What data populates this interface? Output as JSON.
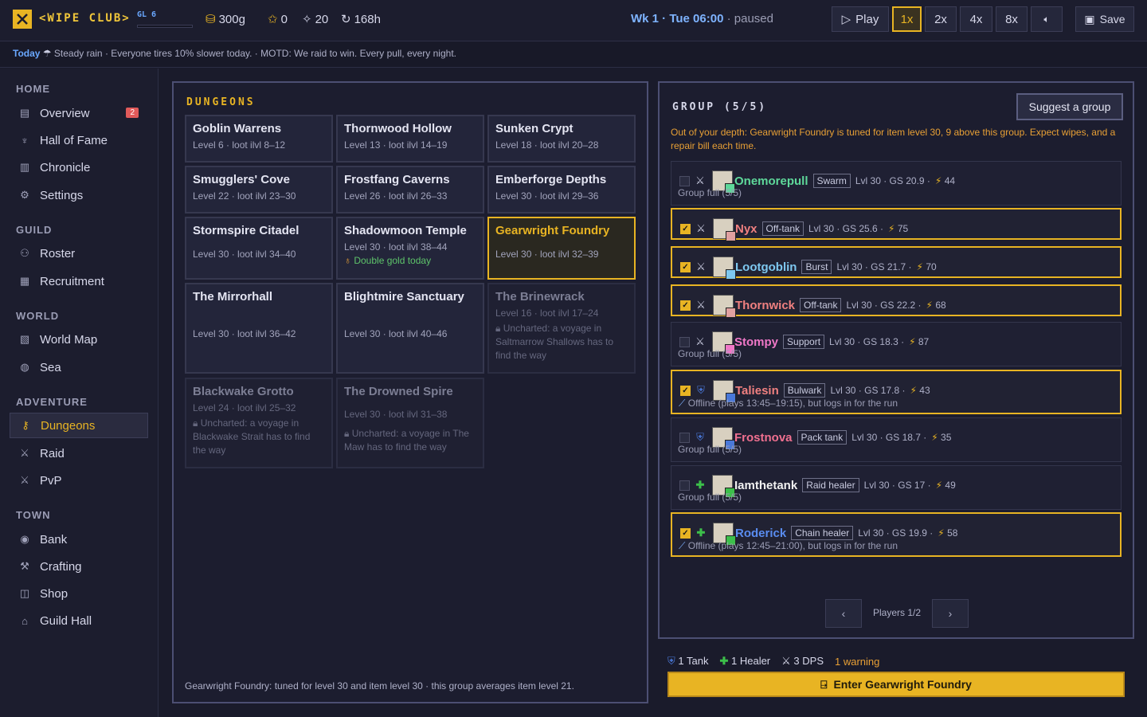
{
  "header": {
    "brand": "<WIPE CLUB>",
    "guild_level": "GL 6",
    "guild_level_progress": 0.0,
    "gold": "300g",
    "stars": "0",
    "recruits": "20",
    "hours": "168h",
    "time": "Wk 1 · Tue 06:00",
    "state": "· paused",
    "play": "Play",
    "speeds": [
      "1x",
      "2x",
      "4x",
      "8x"
    ],
    "active_speed": "1x",
    "save": "Save"
  },
  "motd": {
    "label": "Today",
    "text": "Steady rain · Everyone tires 10% slower today. · MOTD: We raid to win. Every pull, every night."
  },
  "sidebar": {
    "home": "HOME",
    "overview": "Overview",
    "overview_badge": "2",
    "hall_of_fame": "Hall of Fame",
    "chronicle": "Chronicle",
    "settings": "Settings",
    "guild": "GUILD",
    "roster": "Roster",
    "recruitment": "Recruitment",
    "world": "WORLD",
    "world_map": "World Map",
    "sea": "Sea",
    "adventure": "ADVENTURE",
    "dungeons": "Dungeons",
    "raid": "Raid",
    "pvp": "PvP",
    "town": "TOWN",
    "bank": "Bank",
    "crafting": "Crafting",
    "shop": "Shop",
    "guild_hall": "Guild Hall"
  },
  "dungeons": {
    "title": "DUNGEONS",
    "items": [
      {
        "name": "Goblin Warrens",
        "meta": "Level 6 · loot ilvl 8–12"
      },
      {
        "name": "Thornwood Hollow",
        "meta": "Level 13 · loot ilvl 14–19"
      },
      {
        "name": "Sunken Crypt",
        "meta": "Level 18 · loot ilvl 20–28"
      },
      {
        "name": "Smugglers' Cove",
        "meta": "Level 22 · loot ilvl 23–30"
      },
      {
        "name": "Frostfang Caverns",
        "meta": "Level 26 · loot ilvl 26–33"
      },
      {
        "name": "Emberforge Depths",
        "meta": "Level 30 · loot ilvl 29–36"
      },
      {
        "name": "Stormspire Citadel",
        "meta": "Level 30 · loot ilvl 34–40"
      },
      {
        "name": "Shadowmoon Temple",
        "meta": "Level 30 · loot ilvl 38–44",
        "extra": "Double gold today"
      },
      {
        "name": "Gearwright Foundry",
        "meta": "Level 30 · loot ilvl 32–39"
      },
      {
        "name": "The Mirrorhall",
        "meta": "Level 30 · loot ilvl 36–42"
      },
      {
        "name": "Blightmire Sanctuary",
        "meta": "Level 30 · loot ilvl 40–46"
      },
      {
        "name": "The Brinewrack",
        "meta": "Level 16 · loot ilvl 17–24",
        "lock": "Uncharted: a voyage in Saltmarrow Shallows has to find the way"
      },
      {
        "name": "Blackwake Grotto",
        "meta": "Level 24 · loot ilvl 25–32",
        "lock": "Uncharted: a voyage in Blackwake Strait has to find the way"
      },
      {
        "name": "The Drowned Spire",
        "meta": "Level 30 · loot ilvl 31–38",
        "lock": "Uncharted: a voyage in The Maw has to find the way"
      }
    ],
    "footer": "Gearwright Foundry: tuned for level 30 and item level 30 · this group averages item level 21."
  },
  "group": {
    "title": "GROUP (5/5)",
    "suggest": "Suggest a group",
    "warning": "Out of your depth: Gearwright Foundry is tuned for item level 30, 9 above this group. Expect wipes, and a repair bill each time.",
    "players": [
      {
        "name": "Onemorepull",
        "tag": "Swarm",
        "stats": "Lvl 30 · GS 20.9 ·",
        "energy": "44",
        "sub": "Group full (5/5)",
        "checked": false,
        "role": "dps",
        "color": "#5ed89a",
        "badge": "#5ed89a"
      },
      {
        "name": "Nyx",
        "tag": "Off-tank",
        "stats": "Lvl 30 · GS 25.6 ·",
        "energy": "75",
        "sub": "",
        "checked": true,
        "role": "dps",
        "color": "#f08080",
        "badge": "#e0a0a0"
      },
      {
        "name": "Lootgoblin",
        "tag": "Burst",
        "stats": "Lvl 30 · GS 21.7 ·",
        "energy": "70",
        "sub": "",
        "checked": true,
        "role": "dps",
        "color": "#7ec8f0",
        "badge": "#7ec8f0"
      },
      {
        "name": "Thornwick",
        "tag": "Off-tank",
        "stats": "Lvl 30 · GS 22.2 ·",
        "energy": "68",
        "sub": "",
        "checked": true,
        "role": "dps",
        "color": "#f08080",
        "badge": "#e0a0a0"
      },
      {
        "name": "Stompy",
        "tag": "Support",
        "stats": "Lvl 30 · GS 18.3 ·",
        "energy": "87",
        "sub": "Group full (5/5)",
        "checked": false,
        "role": "dps",
        "color": "#f078c8",
        "badge": "#f078c8"
      },
      {
        "name": "Taliesin",
        "tag": "Bulwark",
        "stats": "Lvl 30 · GS 17.8 ·",
        "energy": "43",
        "sub": "Offline (plays 13:45–19:15), but logs in for the run",
        "checked": true,
        "role": "tank",
        "color": "#f08080",
        "badge": "#4a78d8"
      },
      {
        "name": "Frostnova",
        "tag": "Pack tank",
        "stats": "Lvl 30 · GS 18.7 ·",
        "energy": "35",
        "sub": "Group full (5/5)",
        "checked": false,
        "role": "tank",
        "color": "#f07090",
        "badge": "#4a78d8"
      },
      {
        "name": "Iamthetank",
        "tag": "Raid healer",
        "stats": "Lvl 30 · GS 17 ·",
        "energy": "49",
        "sub": "Group full (5/5)",
        "checked": false,
        "role": "heal",
        "color": "#f0f0f0",
        "badge": "#3cbf4a"
      },
      {
        "name": "Roderick",
        "tag": "Chain healer",
        "stats": "Lvl 30 · GS 19.9 ·",
        "energy": "58",
        "sub": "Offline (plays 12:45–21:00), but logs in for the run",
        "checked": true,
        "role": "heal",
        "color": "#5a8cf0",
        "badge": "#3cbf4a"
      }
    ],
    "prev": "‹",
    "next": "›",
    "page": "Players 1/2"
  },
  "composition": {
    "tank": "1 Tank",
    "healer": "1 Healer",
    "dps": "3 DPS",
    "warnings": "1 warning"
  },
  "enter": "Enter Gearwright Foundry",
  "colors": {
    "accent": "#e8b423",
    "link": "#6aa8ff",
    "warning": "#e8a035",
    "good": "#5ec46a"
  }
}
